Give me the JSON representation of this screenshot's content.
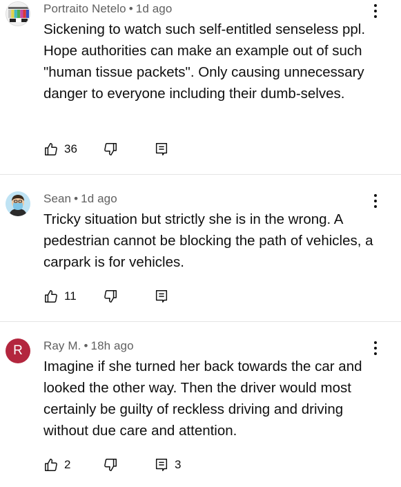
{
  "comments": [
    {
      "author": "Portraito Netelo",
      "time": "1d ago",
      "text": "Sickening to watch such self-entitled senseless ppl. Hope authorities can make an example out of such \"human tissue packets\". Only causing unnecessary danger to everyone including their dumb-selves.",
      "likes": "36",
      "replies": "",
      "avatar": "test-pattern-avatar"
    },
    {
      "author": "Sean",
      "time": "1d ago",
      "text": "Tricky situation but strictly she is in the wrong. A pedestrian cannot be blocking the path of vehicles, a carpark is for vehicles.",
      "likes": "11",
      "replies": "",
      "avatar": "masked-person-avatar"
    },
    {
      "author": "Ray M.",
      "time": "18h ago",
      "text": "Imagine if she turned her back towards the car and looked the other way. Then the driver would most certainly be guilty of reckless driving and driving without due care and attention.",
      "likes": "2",
      "replies": "3",
      "avatar_letter": "R",
      "avatar_color": "#b3263e"
    }
  ],
  "icons": {
    "like": "thumb-up-icon",
    "dislike": "thumb-down-icon",
    "reply": "reply-comment-icon",
    "menu": "more-vertical-icon"
  },
  "colors": {
    "meta_text": "#606060",
    "divider": "#e5e5e5",
    "avatar_r": "#b3263e"
  }
}
